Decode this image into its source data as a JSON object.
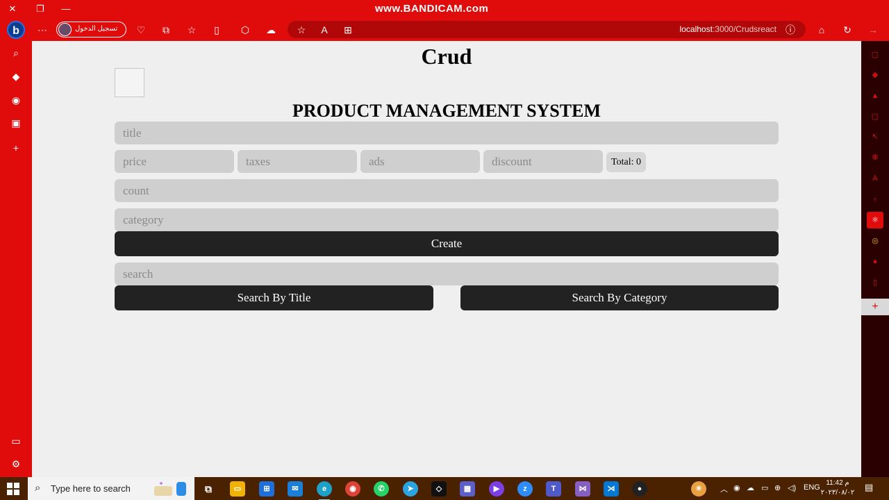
{
  "watermark": "www.BANDICAM.com",
  "browser": {
    "profile_label": "تسجيل الدخول",
    "url_host": "localhost",
    "url_rest": ":3000/Crudsreact"
  },
  "page": {
    "title": "Crud",
    "heading": "PRODUCT MANAGEMENT SYSTEM",
    "inputs": {
      "title": "title",
      "price": "price",
      "taxes": "taxes",
      "ads": "ads",
      "discount": "discount",
      "count": "count",
      "category": "category",
      "search": "search"
    },
    "total_label": "Total: 0",
    "create_label": "Create",
    "search_by_title_label": "Search By Title",
    "search_by_category_label": "Search By Category"
  },
  "taskbar": {
    "search_placeholder": "Type here to search",
    "language": "ENG",
    "time": "11:42 م",
    "date": "٢٠٢٣/٠٨/٠٢"
  },
  "colors": {
    "browser_chrome": "#e00b0b",
    "page_background": "#efefef",
    "input_background": "#cfcfcf",
    "button_background": "#222222"
  }
}
